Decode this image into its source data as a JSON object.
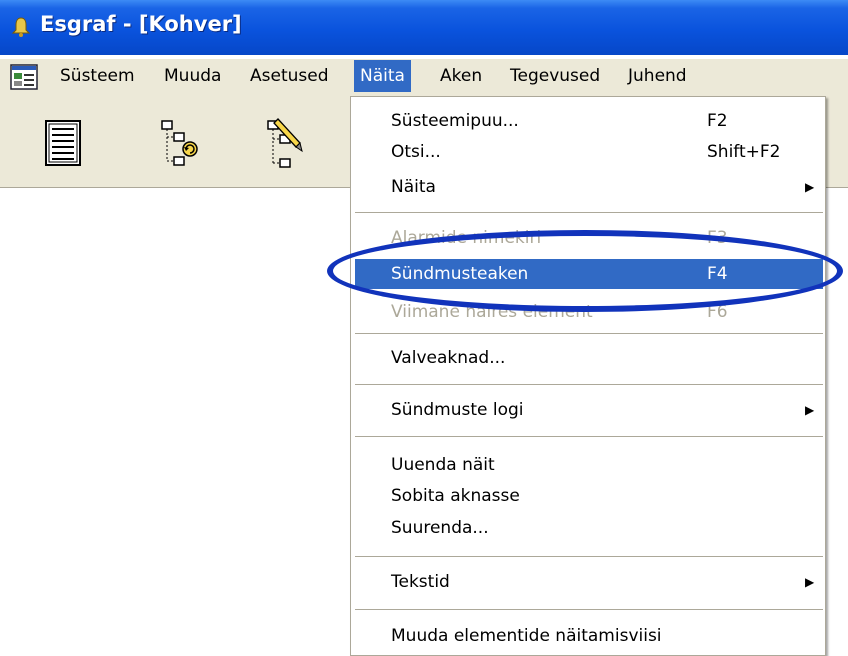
{
  "window": {
    "title": "Esgraf - [Kohver]",
    "title_icon": "bell-icon",
    "app_icon": "app-system-icon"
  },
  "menubar": {
    "items": [
      {
        "label": "Süsteem"
      },
      {
        "label": "Muuda"
      },
      {
        "label": "Asetused"
      },
      {
        "label": "Näita",
        "active": true
      },
      {
        "label": "Aken"
      },
      {
        "label": "Tegevused"
      },
      {
        "label": "Juhend"
      }
    ]
  },
  "toolbar": {
    "buttons": [
      {
        "icon": "document-list-icon"
      },
      {
        "icon": "tree-refresh-icon"
      },
      {
        "icon": "tree-edit-icon"
      }
    ]
  },
  "dropdown": {
    "items": [
      {
        "label": "Süsteemipuu...",
        "shortcut": "F2"
      },
      {
        "label": "Otsi...",
        "shortcut": "Shift+F2"
      },
      {
        "label": "Näita",
        "submenu": true
      },
      {
        "label": "Alarmide nimekiri",
        "shortcut": "F3",
        "disabled": true
      },
      {
        "label": "Sündmusteaken",
        "shortcut": "F4",
        "selected": true
      },
      {
        "label": "Viimane häires element",
        "shortcut": "F6",
        "disabled": true
      },
      {
        "label": "Valveaknad..."
      },
      {
        "label": "Sündmuste logi",
        "submenu": true
      },
      {
        "label": "Uuenda näit"
      },
      {
        "label": "Sobita aknasse"
      },
      {
        "label": "Suurenda..."
      },
      {
        "label": "Tekstid",
        "submenu": true
      },
      {
        "label": "Muuda elementide näitamisviisi"
      }
    ],
    "submenu_arrow": "▶"
  },
  "colors": {
    "titlebar": "#0a53dd",
    "menu_highlight": "#316ac5",
    "ui_face": "#ece9d8",
    "annotation_ellipse": "#1133bb"
  }
}
